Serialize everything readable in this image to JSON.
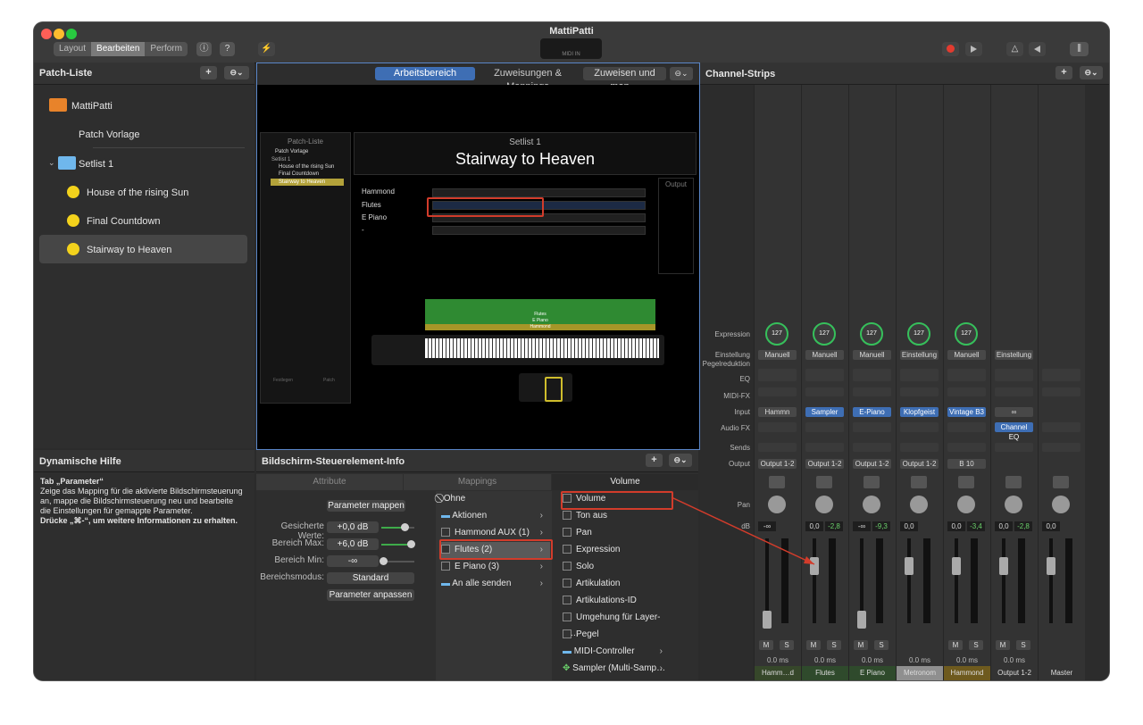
{
  "window": {
    "title": "MattiPatti"
  },
  "toolbar": {
    "modes": [
      "Layout",
      "Bearbeiten",
      "Perform"
    ],
    "active_mode": "Bearbeiten",
    "info_icon": "ⓘ",
    "help_icon": "?",
    "tuning_icon": "⚡",
    "lcd_label": "MIDI IN",
    "metronome_icon": "△"
  },
  "patch_list": {
    "title": "Patch-Liste",
    "add": "+",
    "menu": "⊖⌄",
    "items": [
      {
        "label": "MattiPatti"
      },
      {
        "label": "Patch Vorlage"
      },
      {
        "label": "Setlist 1",
        "disclosure": "⌄"
      },
      {
        "label": "House of the rising Sun"
      },
      {
        "label": "Final Countdown"
      },
      {
        "label": "Stairway to Heaven"
      }
    ]
  },
  "workspace": {
    "tabs": [
      "Arbeitsbereich",
      "Zuweisungen & Mappings",
      "Zuweisen und map…"
    ],
    "menu": "⊖⌄",
    "mini_list": {
      "title": "Patch-Liste",
      "items": [
        "Patch Vorlage",
        "Setlist 1",
        "House of the rising Sun",
        "Final Countdown",
        "Stairway to Heaven"
      ],
      "footer": [
        "Festlegen",
        "Patch"
      ]
    },
    "setlist": "Setlist 1",
    "song": "Stairway to Heaven",
    "tracks": [
      "Hammond",
      "Flutes",
      "E Piano",
      "-"
    ],
    "output_label": "Output",
    "kbd_layers": [
      "Flutes",
      "E Piano",
      "Hammond"
    ]
  },
  "help": {
    "title": "Dynamische Hilfe",
    "heading": "Tab „Parameter“",
    "body": "Zeige das Mapping für die aktivierte Bildschirmsteuerung an, mappe die Bildschirmsteuerung neu und bearbeite die Einstellungen für gemappte Parameter.",
    "bold": "Drücke „⌘-“, um weitere Informationen zu erhalten."
  },
  "info": {
    "title": "Bildschirm-Steuerelement-Info",
    "add": "+",
    "menu": "⊖⌄",
    "tabs": [
      "Attribute",
      "Mappings",
      "Volume"
    ],
    "map_button": "Parameter mappen",
    "fields": [
      {
        "label": "Gesicherte Werte:",
        "value": "+0,0 dB",
        "level": 0.7
      },
      {
        "label": "Bereich Max:",
        "value": "+6,0 dB",
        "level": 0.9
      },
      {
        "label": "Bereich Min:",
        "value": "-∞",
        "level": 0.05
      }
    ],
    "mode_label": "Bereichsmodus:",
    "mode_value": "Standard",
    "adjust_button": "Parameter anpassen",
    "targets": [
      {
        "label": "Ohne",
        "icon": "⃠"
      },
      {
        "label": "Aktionen",
        "icon": "folder",
        "chevron": "›"
      },
      {
        "label": "Hammond AUX (1)",
        "icon": "box",
        "chevron": "›"
      },
      {
        "label": "Flutes (2)",
        "icon": "box",
        "chevron": "›"
      },
      {
        "label": "E Piano (3)",
        "icon": "box",
        "chevron": "›"
      },
      {
        "label": "An alle senden",
        "icon": "folder",
        "chevron": "›"
      }
    ],
    "params": [
      "Volume",
      "Ton aus",
      "Pan",
      "Expression",
      "Solo",
      "Artikulation",
      "Artikulations-ID",
      "Umgehung für Layer-M…",
      "Pegel",
      "MIDI-Controller",
      "Sampler (Multi-Samp…"
    ],
    "param_chevrons": [
      "›",
      "›"
    ]
  },
  "channel_strips": {
    "title": "Channel-Strips",
    "add": "+",
    "menu": "⊖⌄",
    "rows": [
      "Expression",
      "Einstellung",
      "Pegelreduktion",
      "EQ",
      "MIDI-FX",
      "Input",
      "Audio FX",
      "Sends",
      "Output",
      "Pan",
      "dB"
    ],
    "strips": [
      {
        "name": "Hamm…d AUX",
        "expr": "127",
        "setting": "Manuell",
        "input": "Hammn",
        "input_blue": false,
        "output": "Output 1-2",
        "db_l": "-∞",
        "db_r": "",
        "mute": "M",
        "solo": "S",
        "ms": "0.0 ms",
        "name_color": "#36472a",
        "fader": 0.05
      },
      {
        "name": "Flutes",
        "expr": "127",
        "setting": "Manuell",
        "input": "Sampler",
        "input_blue": true,
        "output": "Output 1-2",
        "db_l": "0,0",
        "db_r": "-2,8",
        "mute": "M",
        "solo": "S",
        "ms": "0.0 ms",
        "name_color": "#2f4a2c",
        "fader": 0.75
      },
      {
        "name": "E Piano",
        "expr": "127",
        "setting": "Manuell",
        "input": "E-Piano",
        "input_blue": true,
        "output": "Output 1-2",
        "db_l": "-∞",
        "db_r": "-9,3",
        "mute": "M",
        "solo": "S",
        "ms": "0.0 ms",
        "name_color": "#2f4a2c",
        "fader": 0.05
      },
      {
        "name": "Metronom",
        "expr": "127",
        "setting": "Einstellung",
        "input": "Klopfgeist",
        "input_blue": true,
        "output": "Output 1-2",
        "db_l": "0,0",
        "db_r": "",
        "mute": "",
        "solo": "",
        "ms": "0.0 ms",
        "name_color": "#8f8f8f",
        "fader": 0.75
      },
      {
        "name": "Hammond",
        "expr": "127",
        "setting": "Manuell",
        "input": "Vintage B3",
        "input_blue": true,
        "output": "B 10",
        "db_l": "0,0",
        "db_r": "-3,4",
        "mute": "M",
        "solo": "S",
        "ms": "0.0 ms",
        "name_color": "#6e5a1e",
        "fader": 0.75
      },
      {
        "name": "Output 1-2",
        "expr": "",
        "setting": "Einstellung",
        "input": "∞",
        "input_blue": false,
        "output": "",
        "db_l": "0,0",
        "db_r": "-2,8",
        "mute": "M",
        "solo": "S",
        "ms": "0.0 ms",
        "name_color": "#333333",
        "fader": 0.75,
        "audio_fx": "Channel EQ"
      },
      {
        "name": "Master",
        "expr": "",
        "setting": "",
        "input": "",
        "input_blue": false,
        "output": "",
        "db_l": "0,0",
        "db_r": "",
        "mute": "",
        "solo": "",
        "ms": "",
        "name_color": "#333333",
        "fader": 0.75
      }
    ],
    "scale": [
      "6",
      "3",
      "0",
      "3",
      "6",
      "10",
      "15",
      "20",
      "30",
      "40",
      "60"
    ],
    "meter_scale": [
      "0",
      "3",
      "6",
      "9",
      "12",
      "15",
      "18",
      "21",
      "24",
      "30",
      "35",
      "40",
      "45",
      "50",
      "60"
    ]
  },
  "colors": {
    "accent": "#3e6eb4",
    "highlight": "#d23c2b",
    "knob_ring": "#36c05b",
    "folder": "#e8832a"
  }
}
